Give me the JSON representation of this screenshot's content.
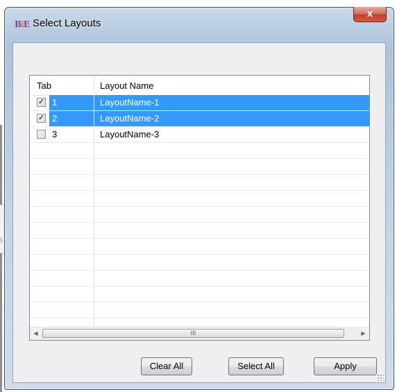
{
  "window": {
    "title": "Select Layouts",
    "icon": "BiE-app-icon",
    "close_label": "x"
  },
  "background": {
    "partial_text": "s"
  },
  "grid": {
    "columns": [
      "Tab",
      "Layout Name"
    ],
    "rows": [
      {
        "checked": true,
        "tab": "1",
        "name": "LayoutName-1",
        "selected": true
      },
      {
        "checked": true,
        "tab": "2",
        "name": "LayoutName-2",
        "selected": true
      },
      {
        "checked": false,
        "tab": "3",
        "name": "LayoutName-3",
        "selected": false
      }
    ],
    "scroll_grip": "III"
  },
  "buttons": {
    "clear_all": "Clear All",
    "select_all": "Select All",
    "apply": "Apply"
  },
  "colors": {
    "selection": "#3399ff",
    "close_button": "#c2402a",
    "frame": "#b9cde3"
  }
}
